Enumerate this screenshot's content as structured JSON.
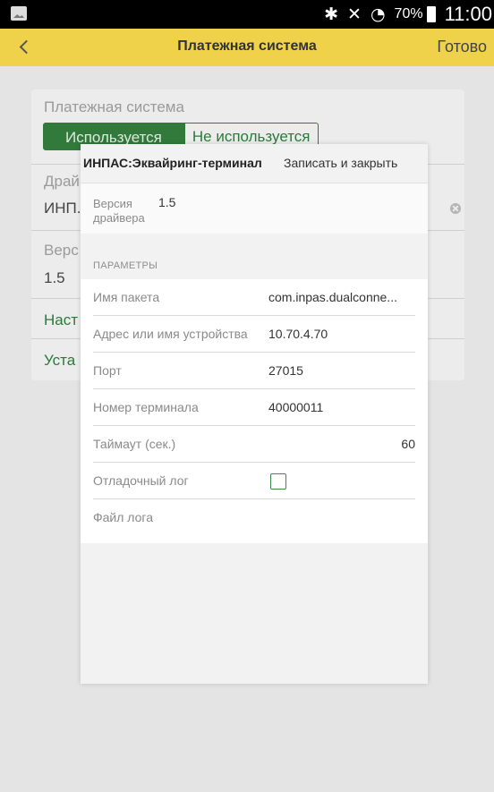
{
  "status_bar": {
    "battery": "70%",
    "time": "11:00"
  },
  "header": {
    "title": "Платежная система",
    "done": "Готово"
  },
  "background_form": {
    "payment_system_label": "Платежная система",
    "toggle_on": "Используется",
    "toggle_off": "Не используется",
    "driver_label": "Драй",
    "driver_value": "ИНП.",
    "version_label": "Верс",
    "version_value": "1.5",
    "settings_link": "Наст",
    "install_link": "Уста"
  },
  "dialog": {
    "title": "ИНПАС:Эквайринг-терминал",
    "save_close": "Записать и закрыть",
    "driver_version_label": "Версия драйвера",
    "driver_version_value": "1.5",
    "params_title": "ПАРАМЕТРЫ",
    "params": [
      {
        "label": "Имя пакета",
        "value": "com.inpas.dualconne..."
      },
      {
        "label": "Адрес или имя устройства",
        "value": "10.70.4.70"
      },
      {
        "label": "Порт",
        "value": "27015"
      },
      {
        "label": "Номер терминала",
        "value": "40000011"
      },
      {
        "label": "Таймаут (сек.)",
        "value": "60"
      },
      {
        "label": "Отладочный лог",
        "checked": false
      },
      {
        "label": "Файл лога",
        "value": ""
      }
    ]
  }
}
